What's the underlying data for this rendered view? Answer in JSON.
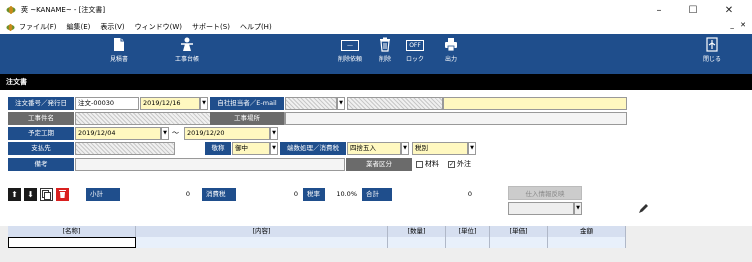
{
  "window": {
    "title": "莢 ~KANAME~ - [注文書]",
    "controls": [
      "–",
      "☐",
      "✕"
    ]
  },
  "menu": {
    "items": [
      "ファイル(F)",
      "編集(E)",
      "表示(V)",
      "ウィンドウ(W)",
      "サポート(S)",
      "ヘルプ(H)"
    ],
    "mdi_controls": "_ ✕"
  },
  "toolbar": {
    "estimate": "見積書",
    "ledger": "工事台帳",
    "delete_request": "削除依頼",
    "delete": "削除",
    "lock": "ロック",
    "lock_state": "OFF",
    "output": "出力",
    "close": "閉じる"
  },
  "section": {
    "title": "注文書"
  },
  "form": {
    "order_no_label": "注文番号／発行日",
    "order_no": "注文-00030",
    "issue_date": "2019/12/16",
    "staff_label": "自社担当者／E-mail",
    "project_name_label": "工事件名",
    "site_label": "工事場所",
    "period_label": "予定工期",
    "period_start": "2019/12/04",
    "tilde": "～",
    "period_end": "2019/12/20",
    "payee_label": "支払先",
    "honorific_label": "敬称",
    "honorific": "御中",
    "rounding_label": "端数処理／消費税",
    "rounding": "四捨五入",
    "tax_type": "税別",
    "note_label": "備考",
    "trade_label": "業者区分",
    "material": "材料",
    "outsourcing": "外注",
    "material_checked": false,
    "outsourcing_checked": true
  },
  "summary": {
    "subtotal_label": "小計",
    "subtotal": "0",
    "tax_label": "消費税",
    "tax": "0",
    "rate_label": "税率",
    "rate": "10.0%",
    "total_label": "合計",
    "total": "0",
    "supplier_btn": "仕入情報反映"
  },
  "grid": {
    "headers": [
      "[名称]",
      "[内容]",
      "[数量]",
      "[単位]",
      "[単価]",
      "金額"
    ]
  },
  "colors": {
    "primary": "#1f4e8c",
    "label_gray": "#6b6b6b",
    "yellow": "#fff8c0"
  }
}
